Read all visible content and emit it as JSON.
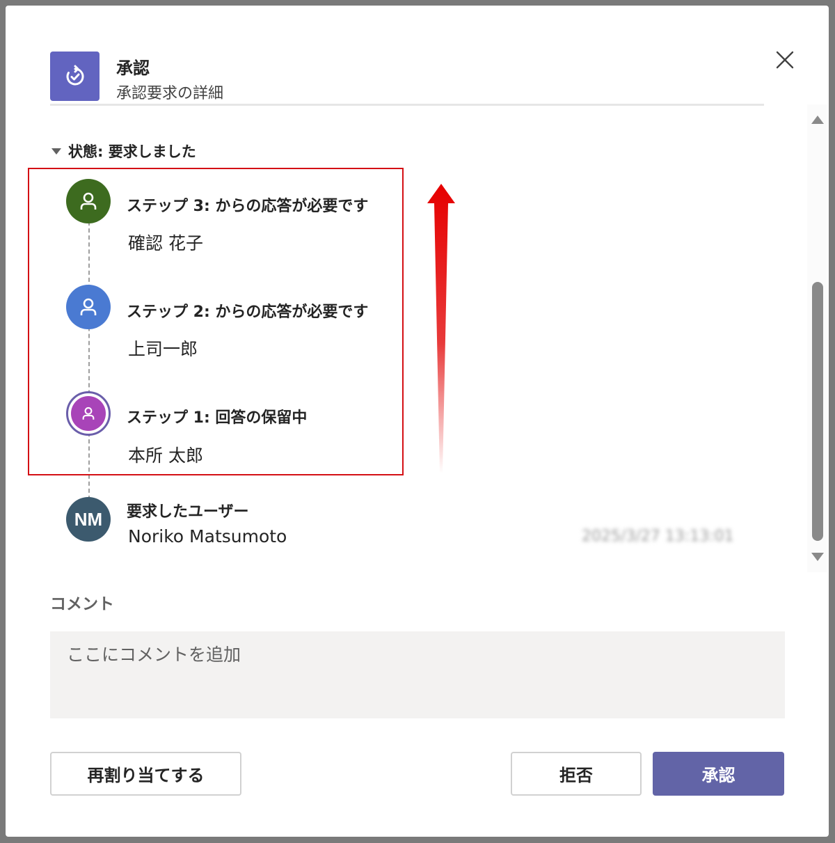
{
  "header": {
    "app_icon": "approvals-icon",
    "title": "承認",
    "subtitle": "承認要求の詳細",
    "close_icon": "close-icon"
  },
  "status": {
    "label": "状態: 要求しました"
  },
  "steps": [
    {
      "title": "ステップ 3: からの応答が必要です",
      "name": "確認 花子",
      "avatar_color": "#3d6b1f",
      "icon": "person-icon"
    },
    {
      "title": "ステップ 2: からの応答が必要です",
      "name": "上司一郎",
      "avatar_color": "#4a7ad2",
      "icon": "person-icon"
    },
    {
      "title": "ステップ 1: 回答の保留中",
      "name": "本所 太郎",
      "avatar_color": "#a844b8",
      "icon": "person-icon"
    }
  ],
  "requester": {
    "title": "要求したユーザー",
    "name": "Noriko Matsumoto",
    "initials": "NM",
    "timestamp": "2025/3/27 13:13:01",
    "avatar_color": "#3c5a6e"
  },
  "annotation": {
    "highlight_color": "#d40f14",
    "arrow_color": "#e60000",
    "arrow_icon": "arrow-up-icon"
  },
  "comment": {
    "label": "コメント",
    "placeholder": "ここにコメントを追加",
    "value": ""
  },
  "buttons": {
    "reassign": "再割り当てする",
    "reject": "拒否",
    "approve": "承認"
  },
  "colors": {
    "accent": "#6264a7",
    "app_icon_bg": "#6264c0"
  }
}
